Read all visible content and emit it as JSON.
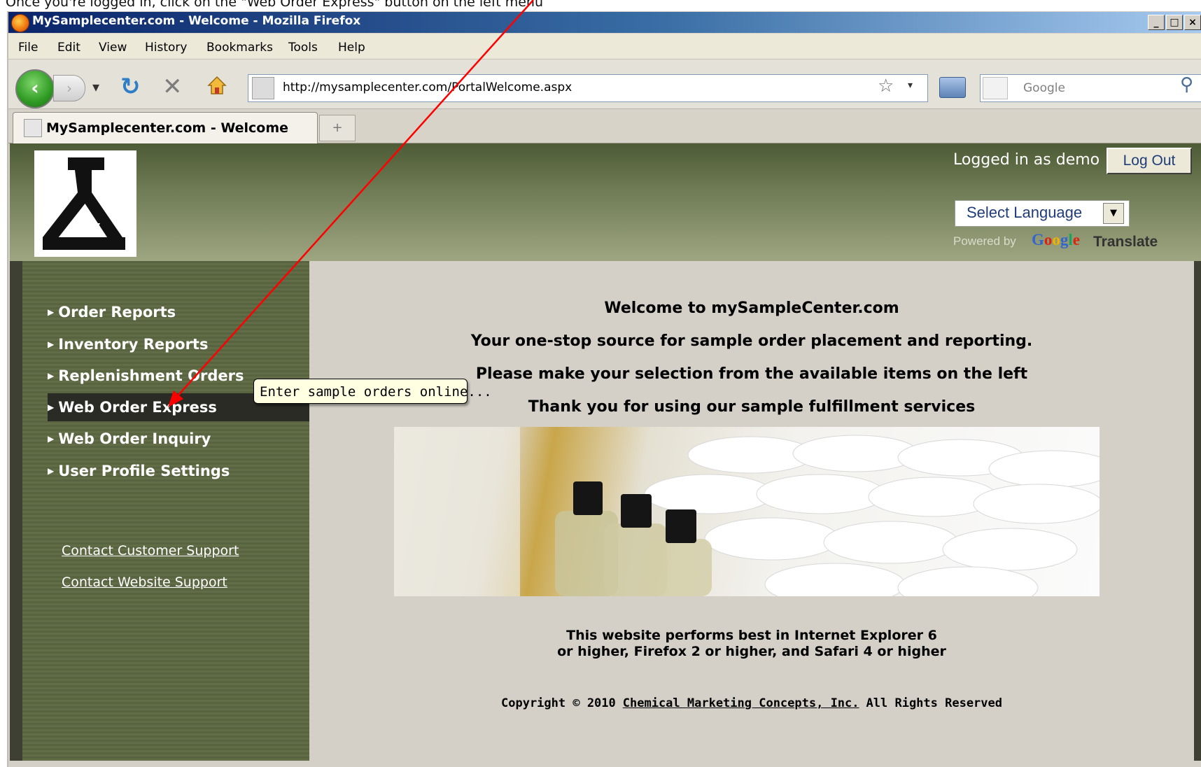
{
  "caption": "Once you're logged in, click on the \"Web Order Express\" button on the left menu",
  "window": {
    "title": "MySamplecenter.com - Welcome - Mozilla Firefox",
    "controls": [
      "_",
      "□",
      "×"
    ]
  },
  "menu": [
    "File",
    "Edit",
    "View",
    "History",
    "Bookmarks",
    "Tools",
    "Help"
  ],
  "toolbar": {
    "url": "http://mysamplecenter.com/PortalWelcome.aspx",
    "search_placeholder": "Google"
  },
  "tabs": [
    {
      "label": "MySamplecenter.com - Welcome",
      "active": true
    }
  ],
  "header": {
    "logged_in_text": "Logged in as demo",
    "logout_label": "Log Out",
    "language_select": "Select Language",
    "powered_by": "Powered by",
    "google": "Google",
    "translate": "Translate"
  },
  "sidebar": {
    "items": [
      {
        "label": "Order Reports",
        "active": false
      },
      {
        "label": "Inventory Reports",
        "active": false
      },
      {
        "label": "Replenishment Orders",
        "active": false
      },
      {
        "label": "Web Order Express",
        "active": true
      },
      {
        "label": "Web Order Inquiry",
        "active": false
      },
      {
        "label": "User Profile Settings",
        "active": false
      }
    ],
    "links": [
      "Contact Customer Support",
      "Contact Website Support"
    ]
  },
  "tooltip": "Enter sample orders online...",
  "main": {
    "welcome_lines": [
      "Welcome to mySampleCenter.com",
      "Your one-stop source for sample order placement and reporting.",
      "Please make your selection from the available items on the left",
      "Thank you for using our sample fulfillment services"
    ],
    "browser_note_lines": [
      "This website performs best in Internet Explorer 6",
      "or higher, Firefox 2 or higher, and Safari 4 or higher"
    ],
    "copyright_prefix": "Copyright © 2010",
    "copyright_company": "Chemical Marketing Concepts, Inc.",
    "copyright_suffix": "All Rights Reserved"
  },
  "colors": {
    "annotation_arrow": "#ff0000",
    "sidebar": "#5d6843",
    "header_dark": "#4d5b36",
    "tooltip_bg": "#ffffe1"
  }
}
